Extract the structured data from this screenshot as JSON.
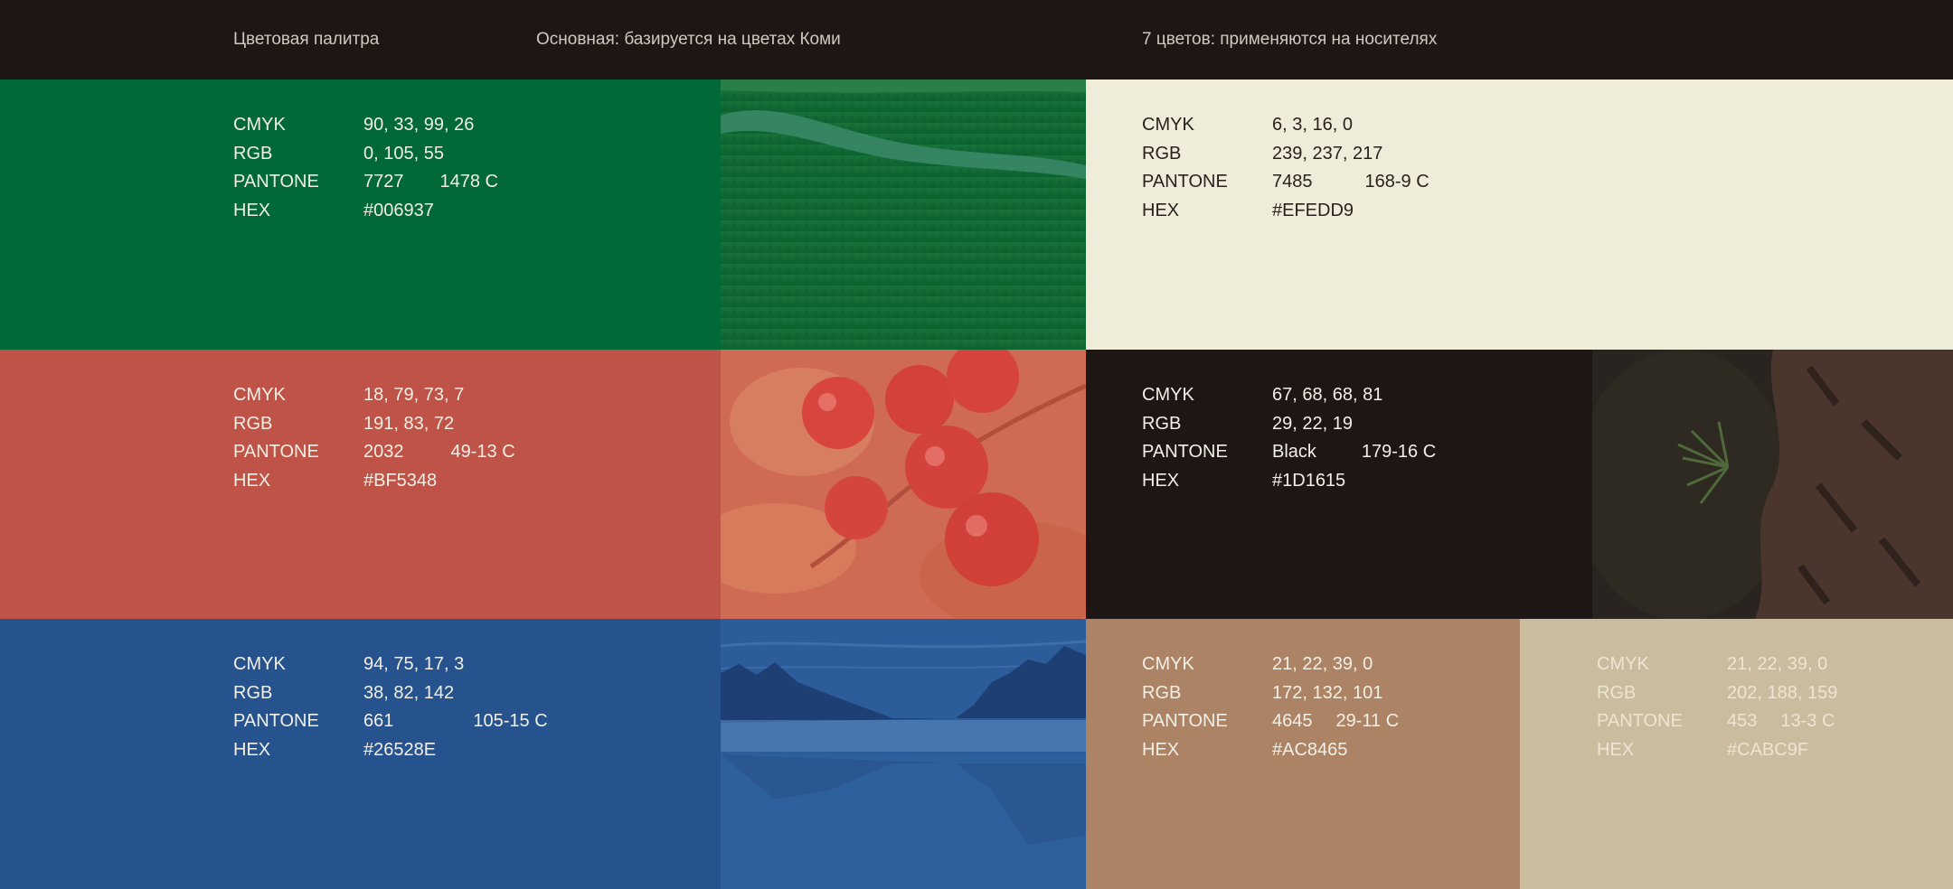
{
  "header": {
    "palette_title": "Цветовая палитра",
    "primary_note": "Основная: базируется на цветах Коми",
    "secondary_note": "7 цветов: применяются на носителях"
  },
  "labels": {
    "cmyk": "CMYK",
    "rgb": "RGB",
    "pantone": "PANTONE",
    "hex": "HEX"
  },
  "colors": {
    "green": {
      "swatch": "#006937",
      "cmyk": "90, 33, 99, 26",
      "rgb": "0, 105, 55",
      "pantone": "7727",
      "pantone_alt": "1478 C",
      "hex": "#006937"
    },
    "red": {
      "swatch": "#BF5348",
      "cmyk": "18, 79, 73, 7",
      "rgb": "191, 83, 72",
      "pantone": "2032",
      "pantone_alt": "49-13 C",
      "hex": "#BF5348"
    },
    "blue": {
      "swatch": "#26528E",
      "cmyk": "94, 75, 17, 3",
      "rgb": "38, 82, 142",
      "pantone": "661",
      "pantone_alt": "105-15 C",
      "hex": "#26528E"
    },
    "cream": {
      "swatch": "#EFEDD9",
      "cmyk": "6, 3, 16, 0",
      "rgb": "239, 237, 217",
      "pantone": "7485",
      "pantone_alt": "168-9 C",
      "hex": "#EFEDD9"
    },
    "black": {
      "swatch": "#1D1615",
      "cmyk": "67, 68, 68, 81",
      "rgb": "29, 22, 19",
      "pantone": "Black",
      "pantone_alt": "179-16 C",
      "hex": "#1D1615"
    },
    "brown": {
      "swatch": "#AC8465",
      "cmyk": "21, 22, 39, 0",
      "rgb": "172, 132, 101",
      "pantone": "4645",
      "pantone_alt": "29-11 C",
      "hex": "#AC8465"
    },
    "sand": {
      "swatch": "#CABC9F",
      "cmyk": "21, 22, 39, 0",
      "rgb": "202, 188, 159",
      "pantone": "453",
      "pantone_alt": "13-3 C",
      "hex": "#CABC9F"
    }
  }
}
